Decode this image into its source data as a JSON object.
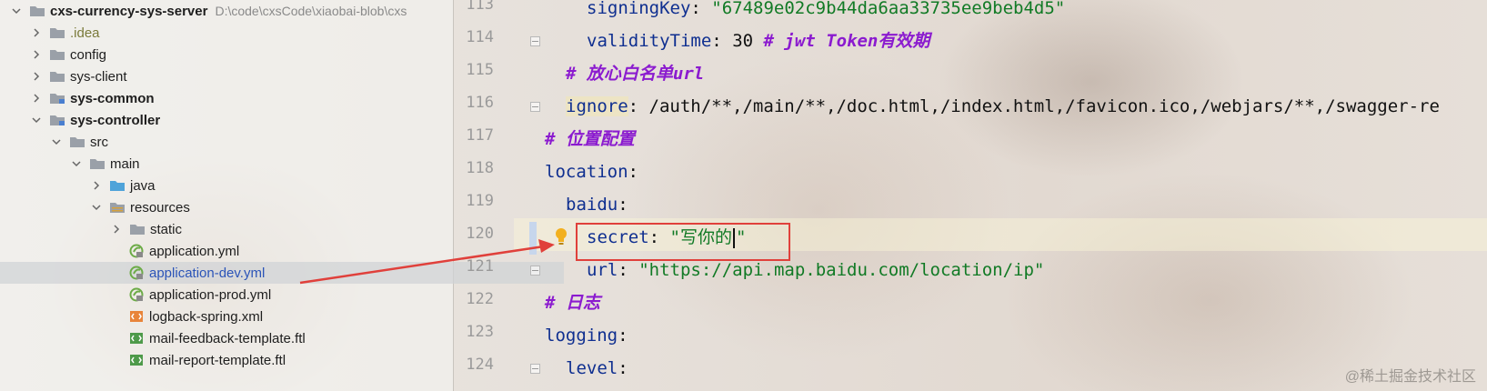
{
  "tree": {
    "root": {
      "name": "cxs-currency-sys-server",
      "path": "D:\\code\\cxsCode\\xiaobai-blob\\cxs"
    },
    "items": [
      {
        "label": ".idea"
      },
      {
        "label": "config"
      },
      {
        "label": "sys-client"
      },
      {
        "label": "sys-common"
      },
      {
        "label": "sys-controller"
      },
      {
        "label": "src"
      },
      {
        "label": "main"
      },
      {
        "label": "java"
      },
      {
        "label": "resources"
      },
      {
        "label": "static"
      },
      {
        "label": "application.yml"
      },
      {
        "label": "application-dev.yml"
      },
      {
        "label": "application-prod.yml"
      },
      {
        "label": "logback-spring.xml"
      },
      {
        "label": "mail-feedback-template.ftl"
      },
      {
        "label": "mail-report-template.ftl"
      }
    ]
  },
  "editor": {
    "line_numbers": [
      "113",
      "114",
      "115",
      "116",
      "117",
      "118",
      "119",
      "120",
      "121",
      "122",
      "123",
      "124"
    ],
    "lines": {
      "l113": {
        "key": "signingKey",
        "value": "\"67489e02c9b44da6aa33735ee9beb4d5\""
      },
      "l114": {
        "key": "validityTime",
        "value": "30",
        "comment": "# jwt Token有效期"
      },
      "l115": {
        "comment": "# 放心白名单url"
      },
      "l116": {
        "key": "ignore",
        "value": "/auth/**,/main/**,/doc.html,/index.html,/favicon.ico,/webjars/**,/swagger-re"
      },
      "l117": {
        "comment": "# 位置配置"
      },
      "l118": {
        "key": "location"
      },
      "l119": {
        "key": "baidu"
      },
      "l120": {
        "key": "secret",
        "value_start": "\"写你的",
        "value_end": "\""
      },
      "l121": {
        "key": "url",
        "value": "\"https://api.map.baidu.com/location/ip\""
      },
      "l122": {
        "comment": "# 日志"
      },
      "l123": {
        "key": "logging"
      },
      "l124": {
        "key": "level"
      }
    },
    "colon": ":"
  },
  "colors": {
    "key": "#0f2f90",
    "string": "#117a25",
    "comment": "#8b1bcf",
    "annotation": "#e0403b",
    "selected_file": "#2b54b8"
  },
  "watermark": "@稀土掘金技术社区"
}
